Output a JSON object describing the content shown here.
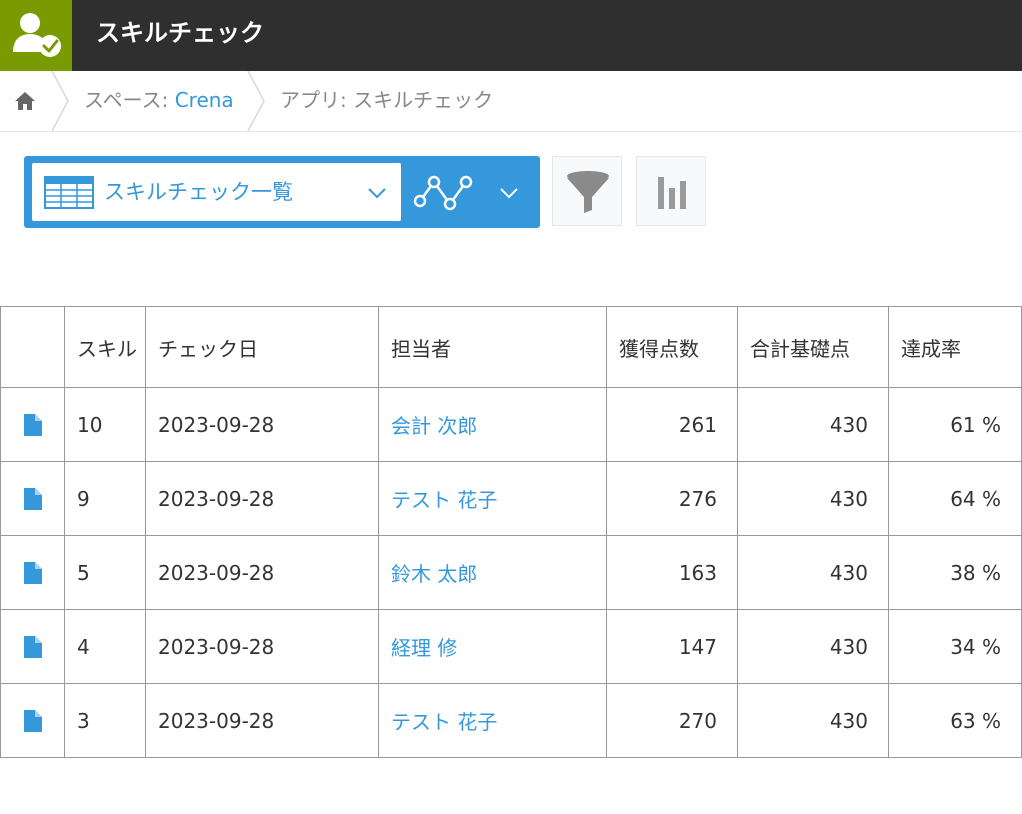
{
  "header": {
    "title": "スキルチェック"
  },
  "breadcrumb": {
    "space_prefix": "スペース: ",
    "space_name": "Crena",
    "app": "アプリ: スキルチェック"
  },
  "view": {
    "name": "スキルチェック一覧"
  },
  "table": {
    "columns": [
      "スキル",
      "チェック日",
      "担当者",
      "獲得点数",
      "合計基礎点",
      "達成率"
    ],
    "rows": [
      {
        "id": "10",
        "date": "2023-09-28",
        "user": "会計 次郎",
        "points": "261",
        "base": "430",
        "rate": "61 %"
      },
      {
        "id": "9",
        "date": "2023-09-28",
        "user": "テスト 花子",
        "points": "276",
        "base": "430",
        "rate": "64 %"
      },
      {
        "id": "5",
        "date": "2023-09-28",
        "user": "鈴木 太郎",
        "points": "163",
        "base": "430",
        "rate": "38 %"
      },
      {
        "id": "4",
        "date": "2023-09-28",
        "user": "経理 修",
        "points": "147",
        "base": "430",
        "rate": "34 %"
      },
      {
        "id": "3",
        "date": "2023-09-28",
        "user": "テスト 花子",
        "points": "270",
        "base": "430",
        "rate": "63 %"
      }
    ]
  },
  "colors": {
    "header_bg": "#2f2f2f",
    "app_icon_bg": "#7a9a01",
    "accent": "#3498db"
  },
  "icons": {
    "app": "user-check-icon",
    "home": "home-icon",
    "view": "table-grid-icon",
    "graph": "line-graph-icon",
    "filter": "filter-funnel-icon",
    "chart": "bar-chart-icon",
    "record": "document-icon"
  }
}
